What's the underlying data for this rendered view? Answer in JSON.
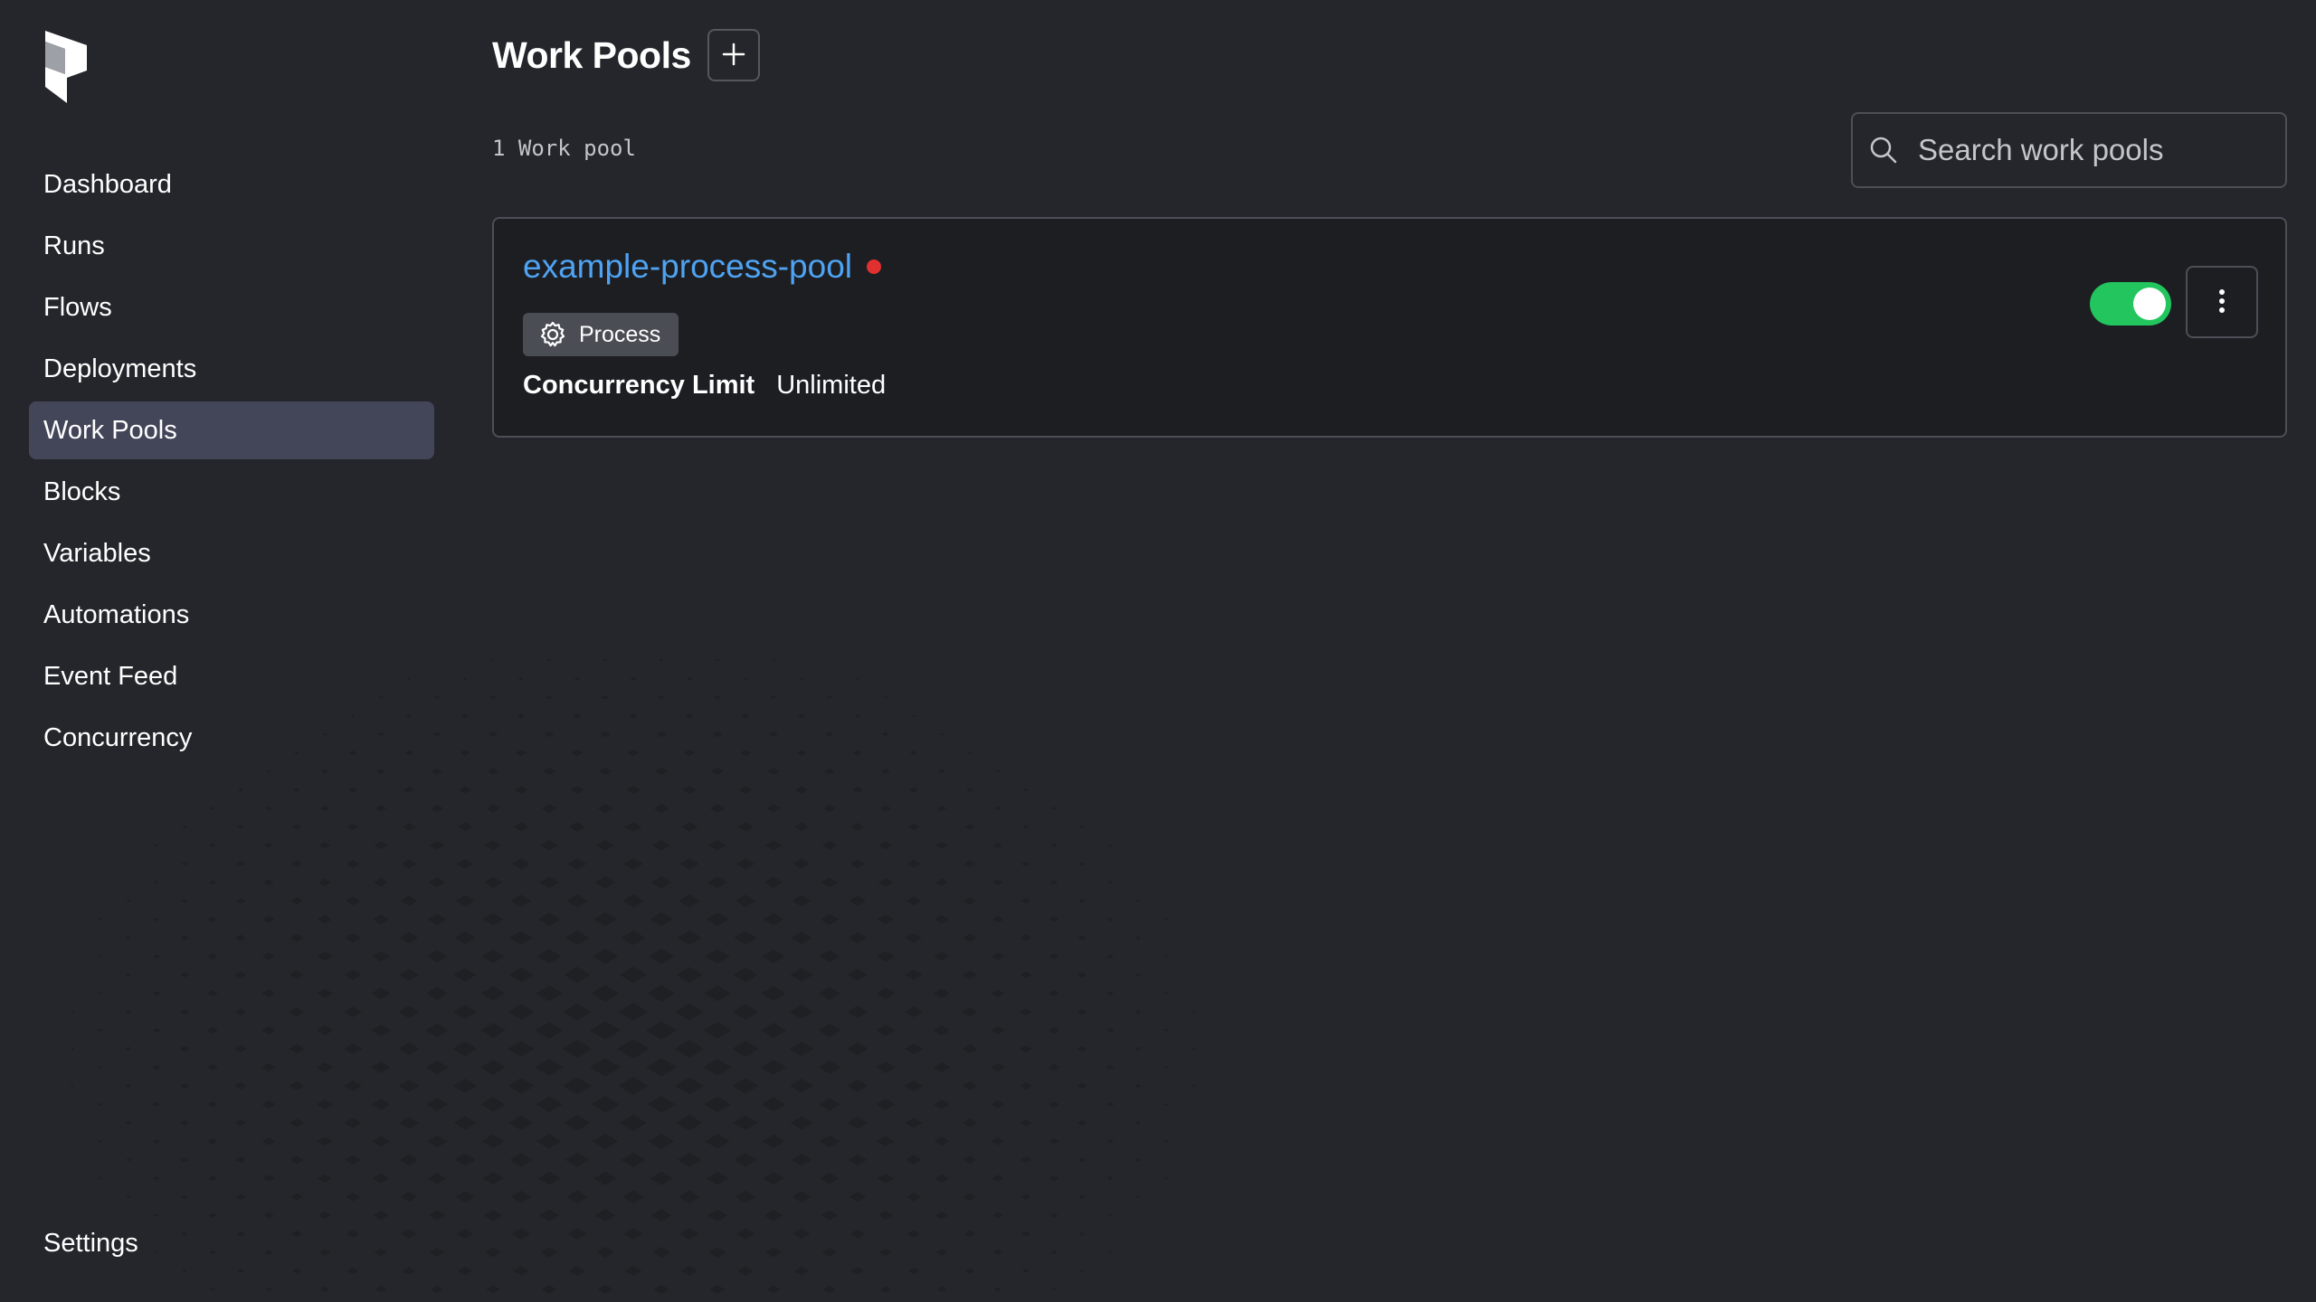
{
  "sidebar": {
    "logo_icon": "prefect-logo-icon",
    "items": [
      {
        "label": "Dashboard",
        "active": false
      },
      {
        "label": "Runs",
        "active": false
      },
      {
        "label": "Flows",
        "active": false
      },
      {
        "label": "Deployments",
        "active": false
      },
      {
        "label": "Work Pools",
        "active": true
      },
      {
        "label": "Blocks",
        "active": false
      },
      {
        "label": "Variables",
        "active": false
      },
      {
        "label": "Automations",
        "active": false
      },
      {
        "label": "Event Feed",
        "active": false
      },
      {
        "label": "Concurrency",
        "active": false
      }
    ],
    "settings_label": "Settings"
  },
  "header": {
    "title": "Work Pools",
    "add_icon": "plus-icon"
  },
  "list": {
    "count_text": "1 Work pool"
  },
  "search": {
    "placeholder": "Search work pools",
    "value": "",
    "icon": "search-icon"
  },
  "work_pools": [
    {
      "name": "example-process-pool",
      "status_color": "#e0302f",
      "type_label": "Process",
      "type_icon": "gear-icon",
      "concurrency_label": "Concurrency Limit",
      "concurrency_value": "Unlimited",
      "enabled": true
    }
  ],
  "colors": {
    "background": "#25262b",
    "card_background": "#1d1e22",
    "active_nav": "#434659",
    "link": "#4ea3f2",
    "toggle_on": "#22c55e",
    "status_red": "#e0302f"
  }
}
